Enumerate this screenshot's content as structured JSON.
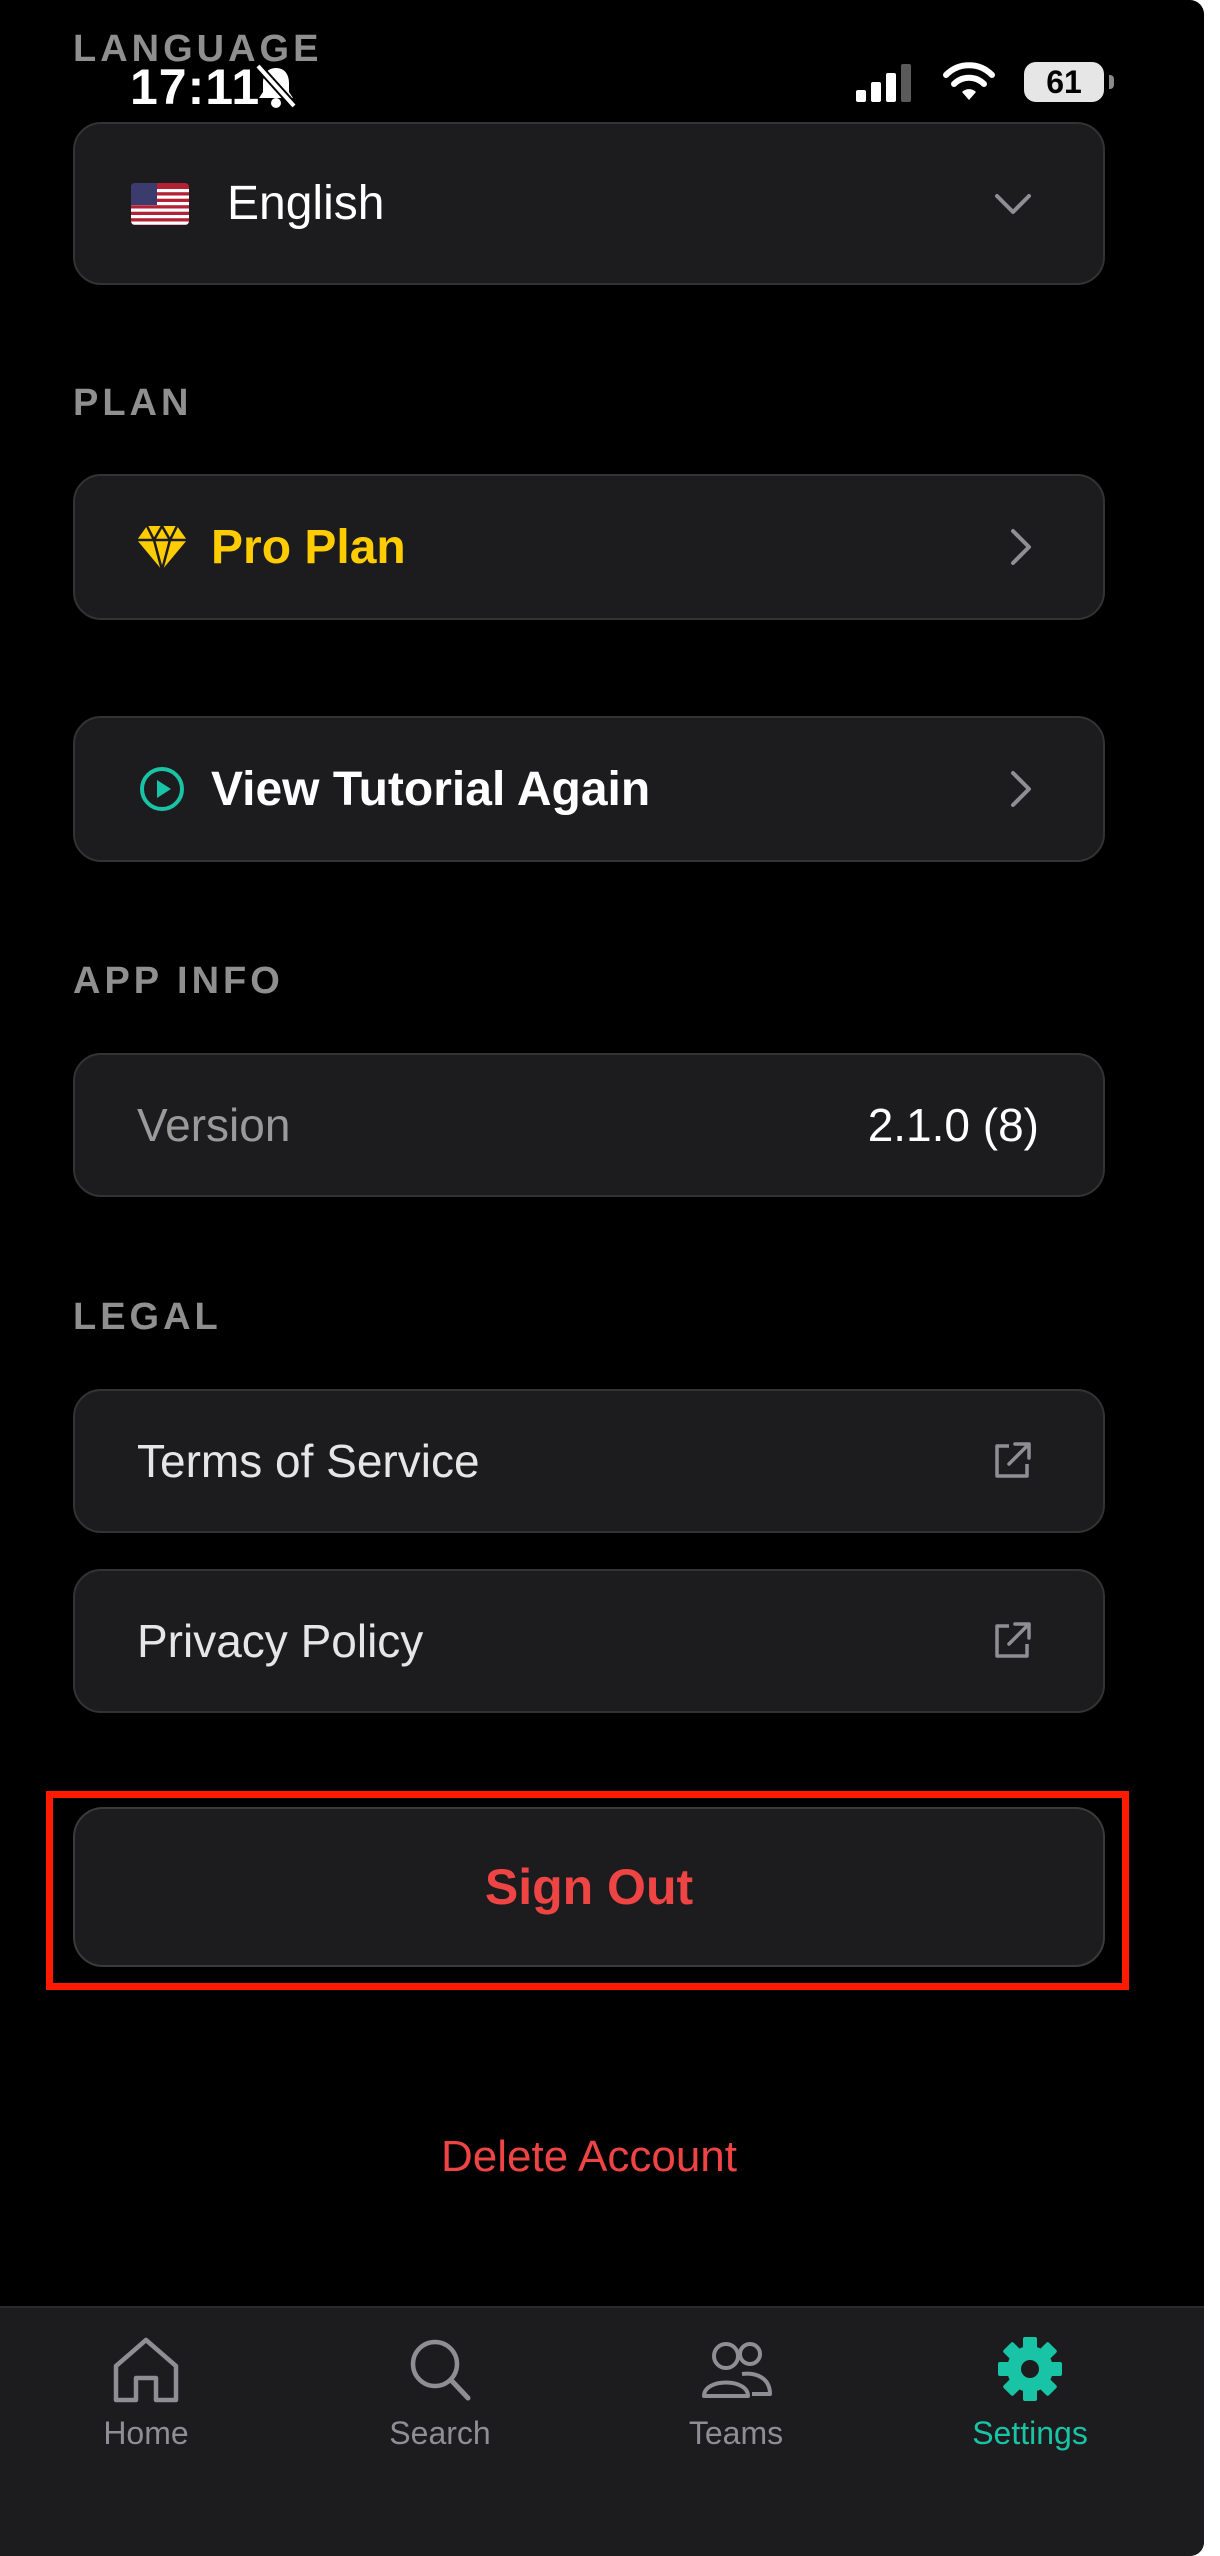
{
  "status_bar": {
    "time": "17:11",
    "battery": "61"
  },
  "language": {
    "section_label": "LANGUAGE",
    "selected": "English"
  },
  "plan": {
    "section_label": "PLAN",
    "plan_label": "Pro Plan"
  },
  "tutorial": {
    "label": "View Tutorial Again"
  },
  "app_info": {
    "section_label": "APP INFO",
    "version_label": "Version",
    "version_value": "2.1.0 (8)"
  },
  "legal": {
    "section_label": "LEGAL",
    "terms": "Terms of Service",
    "privacy": "Privacy Policy"
  },
  "actions": {
    "sign_out": "Sign Out",
    "delete_account": "Delete Account"
  },
  "tabs": [
    {
      "label": "Home",
      "icon": "home-icon"
    },
    {
      "label": "Search",
      "icon": "search-icon"
    },
    {
      "label": "Teams",
      "icon": "teams-icon"
    },
    {
      "label": "Settings",
      "icon": "gear-icon",
      "active": true
    }
  ],
  "colors": {
    "accent": "#19C3A6",
    "danger": "#EF4444",
    "pro": "#FFCC00",
    "highlight": "#FF1A00"
  }
}
